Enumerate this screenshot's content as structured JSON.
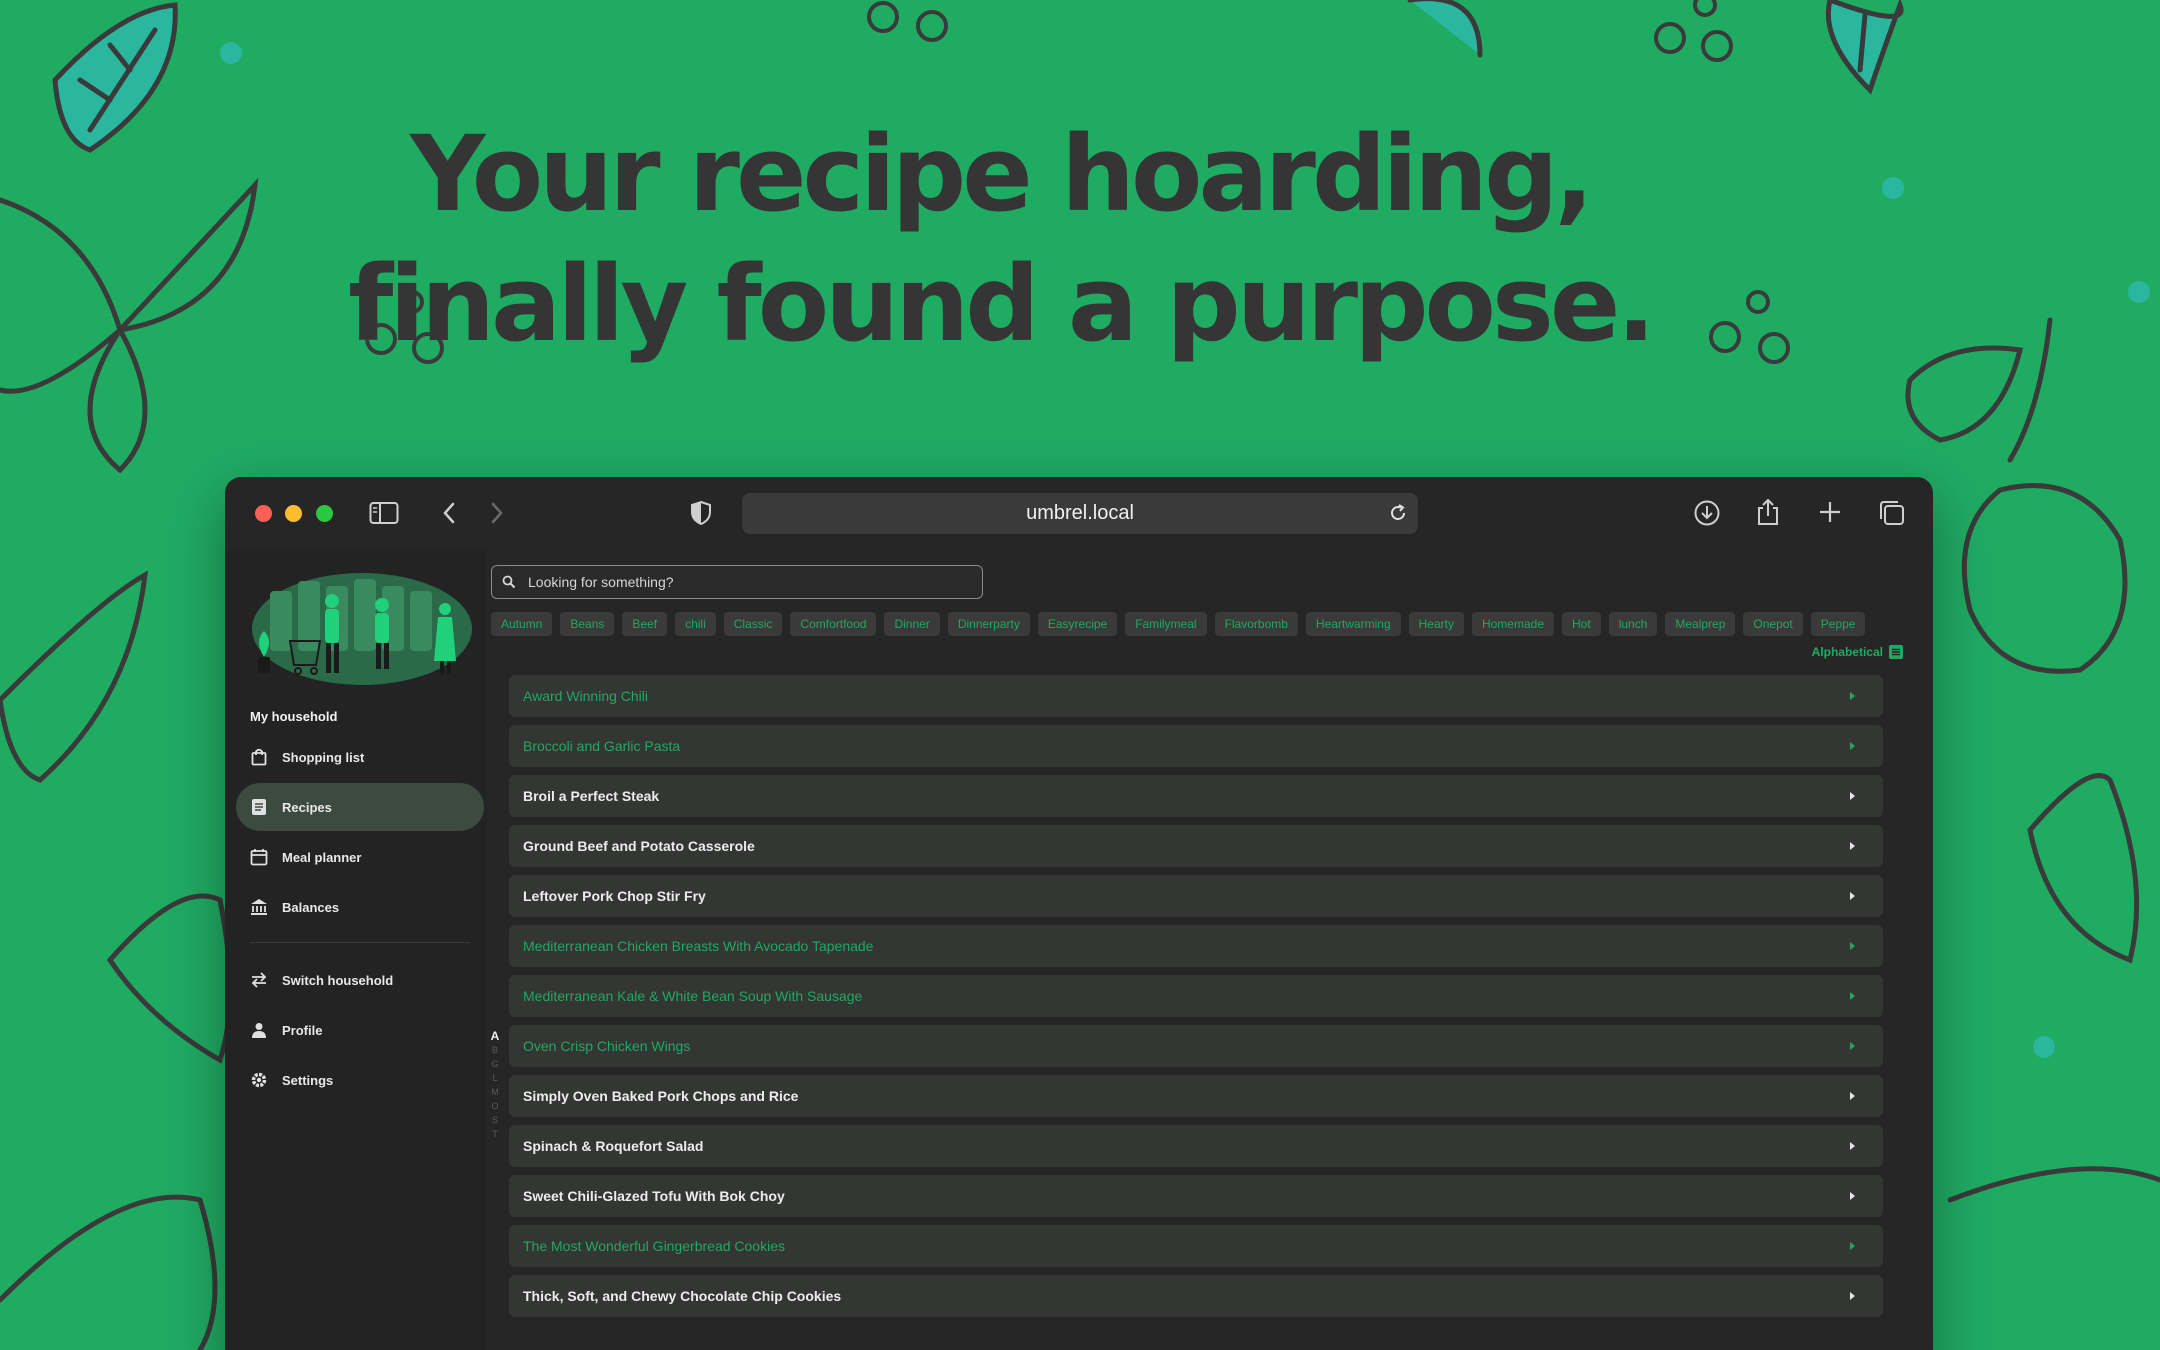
{
  "headline": {
    "line1": "Your recipe hoarding,",
    "line2": "finally found a purpose."
  },
  "browser": {
    "url": "umbrel.local"
  },
  "sidebar": {
    "household_label": "My household",
    "items": [
      {
        "label": "Shopping list",
        "icon": "shopping-bag-icon"
      },
      {
        "label": "Recipes",
        "icon": "recipe-book-icon",
        "active": true
      },
      {
        "label": "Meal planner",
        "icon": "calendar-icon"
      },
      {
        "label": "Balances",
        "icon": "bank-icon"
      },
      {
        "label": "Switch household",
        "icon": "switch-arrows-icon"
      },
      {
        "label": "Profile",
        "icon": "person-icon"
      },
      {
        "label": "Settings",
        "icon": "gear-icon"
      }
    ]
  },
  "search": {
    "placeholder": "Looking for something?"
  },
  "tags": [
    "Autumn",
    "Beans",
    "Beef",
    "chili",
    "Classic",
    "Comfortfood",
    "Dinner",
    "Dinnerparty",
    "Easyrecipe",
    "Familymeal",
    "Flavorbomb",
    "Heartwarming",
    "Hearty",
    "Homemade",
    "Hot",
    "lunch",
    "Mealprep",
    "Onepot",
    "Peppe"
  ],
  "sort": {
    "label": "Alphabetical"
  },
  "alphabet_index": [
    "A",
    "B",
    "G",
    "L",
    "M",
    "O",
    "S",
    "T"
  ],
  "recipes": [
    {
      "title": "Award Winning Chili",
      "highlight": true
    },
    {
      "title": "Broccoli and Garlic Pasta",
      "highlight": true
    },
    {
      "title": "Broil a Perfect Steak",
      "highlight": false
    },
    {
      "title": "Ground Beef and Potato Casserole",
      "highlight": false
    },
    {
      "title": "Leftover Pork Chop Stir Fry",
      "highlight": false
    },
    {
      "title": "Mediterranean Chicken Breasts With Avocado Tapenade",
      "highlight": true
    },
    {
      "title": "Mediterranean Kale & White Bean Soup With Sausage",
      "highlight": true
    },
    {
      "title": "Oven Crisp Chicken Wings",
      "highlight": true
    },
    {
      "title": "Simply Oven Baked Pork Chops and Rice",
      "highlight": false
    },
    {
      "title": "Spinach & Roquefort Salad",
      "highlight": false
    },
    {
      "title": "Sweet Chili-Glazed Tofu With Bok Choy",
      "highlight": false
    },
    {
      "title": "The Most Wonderful Gingerbread Cookies",
      "highlight": true
    },
    {
      "title": "Thick, Soft, and Chewy Chocolate Chip Cookies",
      "highlight": false
    }
  ],
  "fab_label": "+",
  "colors": {
    "background": "#20ab63",
    "accent": "#21a862",
    "window": "#262626"
  }
}
